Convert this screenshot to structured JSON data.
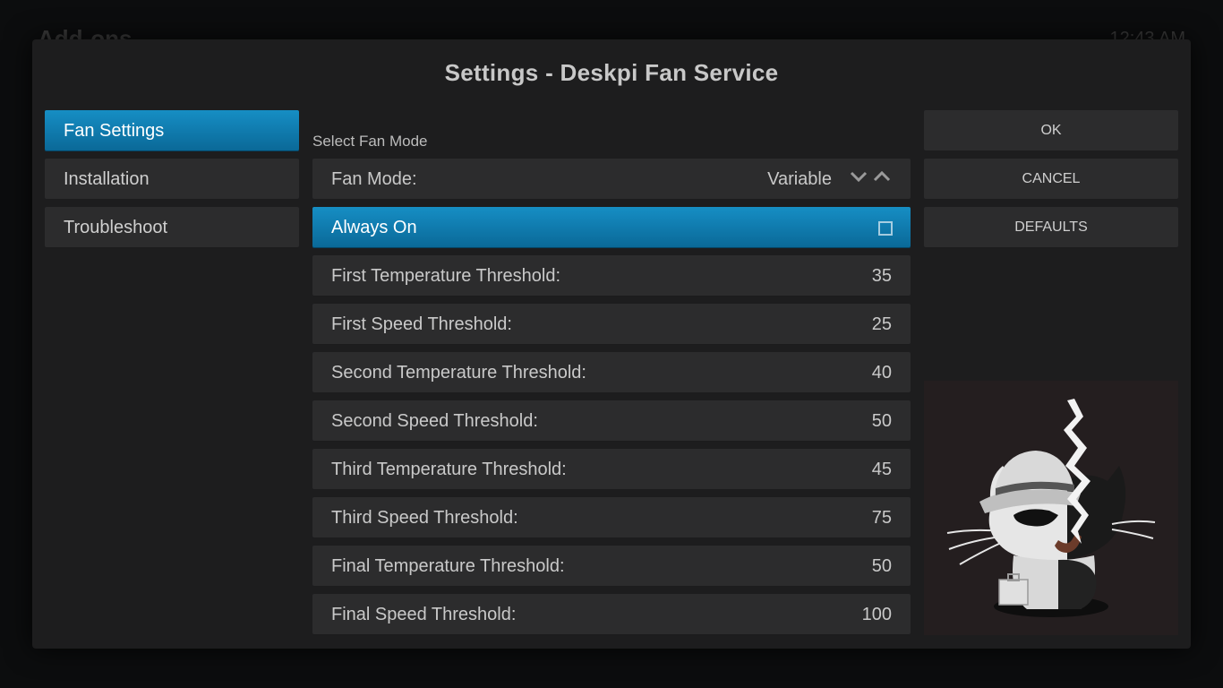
{
  "background": {
    "window_title": "Add-ons",
    "clock": "12:43 AM"
  },
  "dialog": {
    "title": "Settings - Deskpi Fan Service",
    "categories": [
      {
        "label": "Fan Settings",
        "focused": true
      },
      {
        "label": "Installation"
      },
      {
        "label": "Troubleshoot"
      }
    ],
    "section_label": "Select Fan Mode",
    "settings": {
      "fan_mode": {
        "label": "Fan Mode:",
        "value": "Variable"
      },
      "always_on": {
        "label": "Always On",
        "checked": false
      },
      "items": [
        {
          "label": "First Temperature Threshold:",
          "value": "35"
        },
        {
          "label": "First Speed Threshold:",
          "value": "25"
        },
        {
          "label": "Second Temperature Threshold:",
          "value": "40"
        },
        {
          "label": "Second Speed Threshold:",
          "value": "50"
        },
        {
          "label": "Third Temperature Threshold:",
          "value": "45"
        },
        {
          "label": "Third Speed Threshold:",
          "value": "75"
        },
        {
          "label": "Final Temperature Threshold:",
          "value": "50"
        },
        {
          "label": "Final Speed Threshold:",
          "value": "100"
        }
      ]
    },
    "buttons": {
      "ok": "OK",
      "cancel": "CANCEL",
      "defaults": "DEFAULTS"
    }
  },
  "colors": {
    "accent": "#1283b9",
    "dialog_bg": "#1d1d1e",
    "button_bg": "#2c2c2d"
  },
  "icons": {
    "spinner_down": "chevron-down-icon",
    "spinner_up": "chevron-up-icon",
    "addon": "addon-mascot-icon"
  }
}
